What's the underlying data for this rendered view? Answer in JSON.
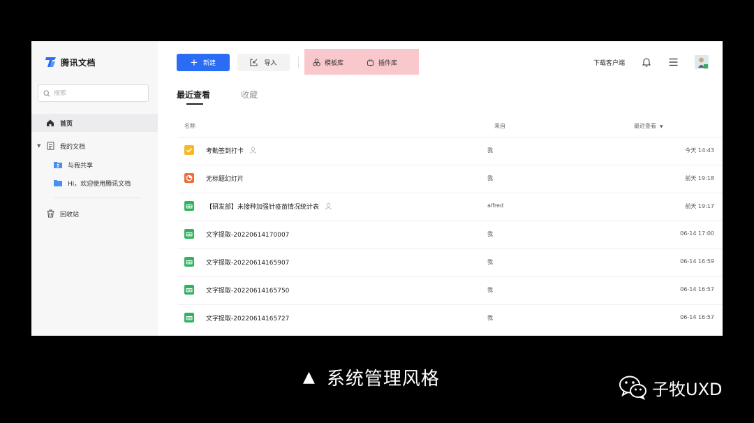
{
  "app": {
    "name": "腾讯文档",
    "brand_color": "#2a6df4"
  },
  "sidebar": {
    "search_placeholder": "搜索",
    "home": "首页",
    "my_docs": "我的文档",
    "shared_with_me": "与我共享",
    "welcome_folder": "Hi，欢迎使用腾讯文档",
    "trash": "回收站"
  },
  "toolbar": {
    "new_label": "新建",
    "import_label": "导入",
    "templates_label": "模板库",
    "plugins_label": "插件库",
    "download_client": "下载客户端",
    "highlight_color": "#f9c8cc"
  },
  "tabs": {
    "recent": "最近查看",
    "favorites": "收藏"
  },
  "table": {
    "headers": {
      "name": "名称",
      "from": "来自",
      "time": "最近查看"
    },
    "rows": [
      {
        "icon": "checkin-icon",
        "name": "考勤签到打卡",
        "shared": true,
        "from": "我",
        "time": "今天 14:43"
      },
      {
        "icon": "slides-icon",
        "name": "无标题幻灯片",
        "shared": false,
        "from": "我",
        "time": "前天 19:18"
      },
      {
        "icon": "sheet-icon",
        "name": "【研发部】未接种加强针疫苗情况统计表",
        "shared": true,
        "from": "alfred",
        "time": "前天 19:17"
      },
      {
        "icon": "sheet-icon",
        "name": "文字提取-20220614170007",
        "shared": false,
        "from": "我",
        "time": "06-14 17:00"
      },
      {
        "icon": "sheet-icon",
        "name": "文字提取-20220614165907",
        "shared": false,
        "from": "我",
        "time": "06-14 16:59"
      },
      {
        "icon": "sheet-icon",
        "name": "文字提取-20220614165750",
        "shared": false,
        "from": "我",
        "time": "06-14 16:57"
      },
      {
        "icon": "sheet-icon",
        "name": "文字提取-20220614165727",
        "shared": false,
        "from": "我",
        "time": "06-14 16:57"
      }
    ]
  },
  "caption": {
    "triangle": "▲",
    "text": "系统管理风格"
  },
  "watermark": {
    "text": "子牧UXD"
  }
}
